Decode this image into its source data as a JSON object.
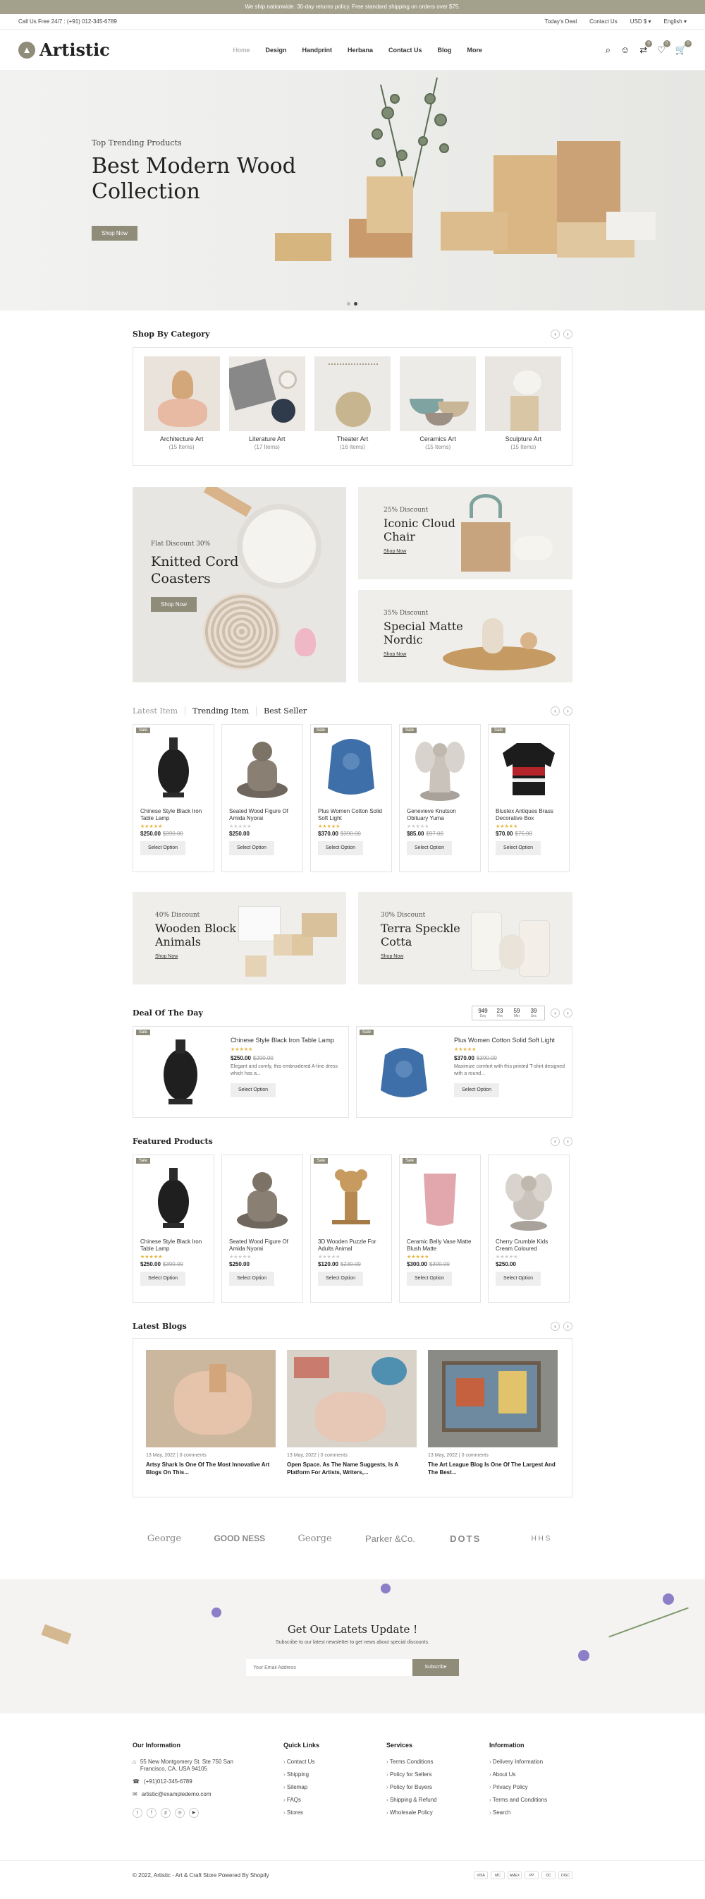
{
  "announce": "We ship nationwide. 30-day returns policy. Free standard shipping on orders over $75.",
  "topbar": {
    "call": "Call Us Free 24/7 : (+91) 012-345-6789",
    "links": [
      "Today's Deal",
      "Contact Us",
      "USD $ ▾",
      "English ▾"
    ]
  },
  "header": {
    "logo": "Artistic",
    "nav": [
      "Home",
      "Design",
      "Handprint",
      "Herbana",
      "Contact Us",
      "Blog",
      "More"
    ],
    "badges": {
      "compare": "0",
      "wishlist": "0",
      "cart": "0"
    }
  },
  "hero": {
    "eyebrow": "Top Trending Products",
    "title": "Best Modern Wood Collection",
    "button": "Shop Now"
  },
  "category": {
    "title": "Shop By Category",
    "items": [
      {
        "name": "Architecture Art",
        "count": "(15 Items)"
      },
      {
        "name": "Literature Art",
        "count": "(17 Items)"
      },
      {
        "name": "Theater Art",
        "count": "(16 Items)"
      },
      {
        "name": "Ceramics Art",
        "count": "(15 Items)"
      },
      {
        "name": "Sculpture Art",
        "count": "(15 Items)"
      }
    ]
  },
  "banners": {
    "b1": {
      "eyebrow": "Flat Discount 30%",
      "title": "Knitted Cord Coasters",
      "button": "Shop Now"
    },
    "b2": {
      "eyebrow": "25% Discount",
      "title": "Iconic Cloud Chair",
      "link": "Shop Now"
    },
    "b3": {
      "eyebrow": "35% Discount",
      "title": "Special Matte Nordic",
      "link": "Shop Now"
    },
    "b4": {
      "eyebrow": "40% Discount",
      "title": "Wooden Block Animals",
      "link": "Shop Now"
    },
    "b5": {
      "eyebrow": "30% Discount",
      "title": "Terra Speckle Cotta",
      "link": "Shop Now"
    }
  },
  "tabs": [
    "Latest Item",
    "Trending Item",
    "Best Seller"
  ],
  "products": [
    {
      "name": "Chinese Style Black Iron Table Lamp",
      "price": "$250.00",
      "old": "$390.00",
      "rated": true,
      "sale": "Sale",
      "button": "Select Option"
    },
    {
      "name": "Seated Wood Figure Of Amida Nyorai",
      "price": "$250.00",
      "old": "",
      "rated": false,
      "sale": "",
      "button": "Select Option"
    },
    {
      "name": "Plus Women Cotton Solid Soft Light",
      "price": "$370.00",
      "old": "$390.00",
      "rated": true,
      "sale": "Sale",
      "button": "Select Option"
    },
    {
      "name": "Genevieve Knutson Obituary Yuma",
      "price": "$85.00",
      "old": "$97.00",
      "rated": false,
      "sale": "Sale",
      "button": "Select Option"
    },
    {
      "name": "Blustex Antiques Brass Decorative Box",
      "price": "$70.00",
      "old": "$75.00",
      "rated": true,
      "sale": "Sale",
      "button": "Select Option"
    }
  ],
  "deal": {
    "title": "Deal Of The Day",
    "countdown": [
      {
        "n": "949",
        "u": "Day"
      },
      {
        "n": "23",
        "u": "Hrs"
      },
      {
        "n": "59",
        "u": "Min"
      },
      {
        "n": "39",
        "u": "Sec"
      }
    ],
    "items": [
      {
        "name": "Chinese Style Black Iron Table Lamp",
        "price": "$250.00",
        "old": "$290.00",
        "desc": "Elegant and comfy, this embroidered A-line dress which has a...",
        "button": "Select Option",
        "sale": "Sale"
      },
      {
        "name": "Plus Women Cotton Solid Soft Light",
        "price": "$370.00",
        "old": "$390.00",
        "desc": "Maximize comfort with this printed T-shirt designed with a round...",
        "button": "Select Option",
        "sale": "Sale"
      }
    ]
  },
  "featured": {
    "title": "Featured Products",
    "items": [
      {
        "name": "Chinese Style Black Iron Table Lamp",
        "price": "$250.00",
        "old": "$390.00",
        "rated": true,
        "sale": "Sale",
        "button": "Select Option"
      },
      {
        "name": "Seated Wood Figure Of Amida Nyorai",
        "price": "$250.00",
        "old": "",
        "rated": false,
        "sale": "",
        "button": "Select Option"
      },
      {
        "name": "3D Wooden Puzzle For Adults Animal",
        "price": "$120.00",
        "old": "$230.00",
        "rated": false,
        "sale": "Sale",
        "button": "Select Option"
      },
      {
        "name": "Ceramic Belly Vase Matte Blush Matte",
        "price": "$300.00",
        "old": "$390.00",
        "rated": true,
        "sale": "Sale",
        "button": "Select Option"
      },
      {
        "name": "Cherry Crumble Kids Cream Coloured",
        "price": "$250.00",
        "old": "",
        "rated": false,
        "sale": "",
        "button": "Select Option"
      }
    ]
  },
  "blogs": {
    "title": "Latest Blogs",
    "items": [
      {
        "meta": "13 May, 2022 | 0 comments",
        "title": "Artsy Shark Is One Of The Most Innovative Art Blogs On This..."
      },
      {
        "meta": "13 May, 2022 | 0 comments",
        "title": "Open Space. As The Name Suggests, Is A Platform For Artists, Writers,..."
      },
      {
        "meta": "13 May, 2022 | 0 comments",
        "title": "The Art League Blog Is One Of The Largest And The Best..."
      }
    ]
  },
  "brands": [
    "George",
    "GOOD NESS",
    "George",
    "Parker &Co.",
    "DOTS",
    "H H S"
  ],
  "newsletter": {
    "title": "Get Our Latets Update !",
    "sub": "Subscribe to our latest newsletter to get news about special discounts.",
    "placeholder": "Your Email Address",
    "button": "Subscribe"
  },
  "footer": {
    "info_title": "Our Information",
    "address": "55 New Montgomery St. Ste 750 San Francisco, CA. USA 94105",
    "phone": "(+91)012-345-6789",
    "email": "artistic@exampledemo.com",
    "quick_title": "Quick Links",
    "quick": [
      "Contact Us",
      "Shipping",
      "Sitemap",
      "FAQs",
      "Stores"
    ],
    "services_title": "Services",
    "services": [
      "Terms Conditions",
      "Policy for Sellers",
      "Policy for Buyers",
      "Shipping & Refund",
      "Wholesale Policy"
    ],
    "information_title": "Information",
    "information": [
      "Delivery Information",
      "About Us",
      "Privacy Policy",
      "Terms and Conditions",
      "Search"
    ],
    "copyright": "© 2022, Artistic - Art & Craft Store Powered By Shopify",
    "payments": [
      "VISA",
      "MC",
      "AMEX",
      "PP",
      "DC",
      "DISC"
    ]
  }
}
